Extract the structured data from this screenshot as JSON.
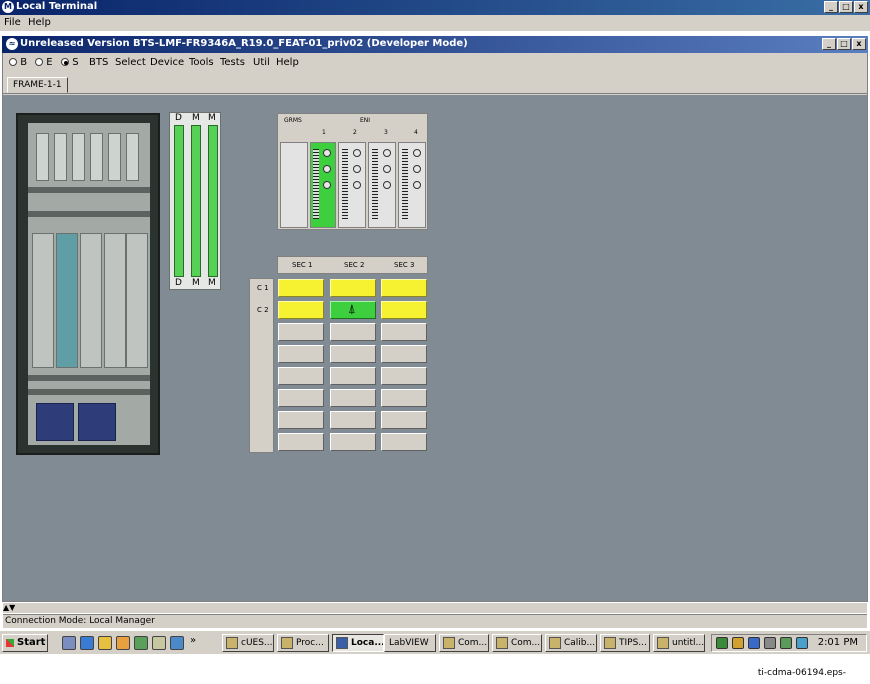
{
  "outer_window": {
    "title": "Local Terminal",
    "menu": [
      "File",
      "Help"
    ]
  },
  "inner_window": {
    "title": "Unreleased Version BTS-LMF-FR9346A_R19.0_FEAT-01_priv02 (Developer Mode)",
    "radios": [
      {
        "label": "B",
        "selected": false
      },
      {
        "label": "E",
        "selected": false
      },
      {
        "label": "S",
        "selected": true
      }
    ],
    "menu": [
      "BTS",
      "Select",
      "Device",
      "Tools",
      "Tests",
      "Util",
      "Help"
    ],
    "tab": "FRAME-1-1"
  },
  "dmm_panel": {
    "labels_top": [
      "D",
      "M",
      "M"
    ],
    "labels_bottom": [
      "D",
      "M",
      "M"
    ]
  },
  "csm_panel": {
    "headers": [
      "GRMS",
      "ENI"
    ],
    "slot_numbers": [
      "1",
      "2",
      "3",
      "4"
    ]
  },
  "sector_grid": {
    "sectors": [
      "SEC 1",
      "SEC 2",
      "SEC 3"
    ],
    "carriers": [
      "C 1",
      "C 2"
    ],
    "row_count": 8,
    "highlight": {
      "row1": [
        "yellow",
        "yellow",
        "yellow"
      ],
      "row2": [
        "yellow",
        "green-tower",
        "yellow"
      ]
    },
    "colors": {
      "yellow": "#f6f231",
      "green": "#3ecf3e"
    }
  },
  "status_bar": {
    "text": "Connection Mode: Local Manager"
  },
  "taskbar": {
    "start": "Start",
    "tasks": [
      "cUES...",
      "Proc...",
      "Loca...",
      "LabVIEW",
      "Com...",
      "Com...",
      "Calib...",
      "TIPS...",
      "untitl..."
    ],
    "active_task": "Loca...",
    "clock": "2:01 PM"
  },
  "caption": "ti-cdma-06194.eps-"
}
